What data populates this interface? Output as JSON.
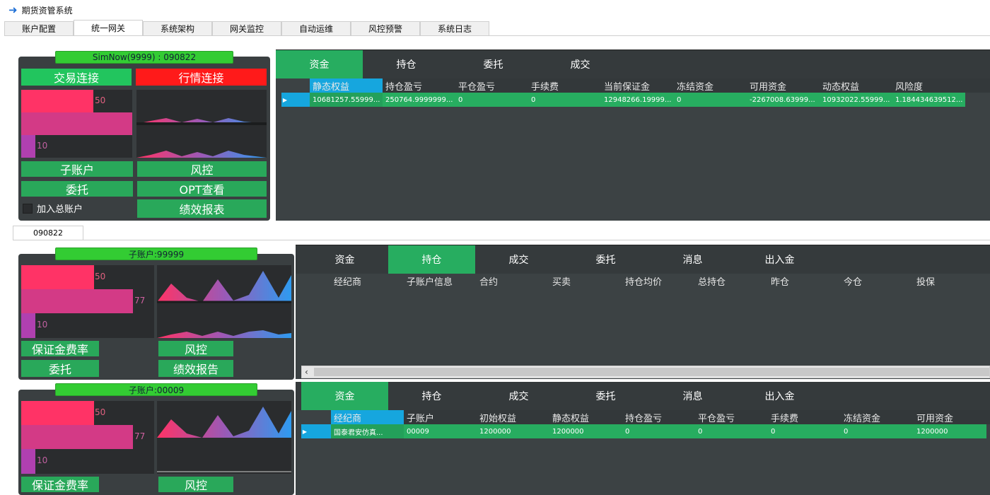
{
  "window": {
    "title": "期货资管系统"
  },
  "main_tabs": [
    {
      "label": "账户配置"
    },
    {
      "label": "统一网关"
    },
    {
      "label": "系统架构"
    },
    {
      "label": "网关监控"
    },
    {
      "label": "自动运维"
    },
    {
      "label": "风控预警"
    },
    {
      "label": "系统日志"
    }
  ],
  "gateway": {
    "label": "SimNow(9999) : 090822",
    "trade_conn": "交易连接",
    "quote_conn": "行情连接",
    "bar_top": "50",
    "bar_bottom": "10",
    "buttons": {
      "sub_account": "子账户",
      "risk": "风控",
      "order": "委托",
      "opt": "OPT查看",
      "report": "绩效报表"
    },
    "checkbox_label": "加入总账户"
  },
  "top_grid": {
    "tabs": [
      "资金",
      "持仓",
      "委托",
      "成交"
    ],
    "headers": [
      "静态权益",
      "持仓盈亏",
      "平仓盈亏",
      "手续费",
      "当前保证金",
      "冻结资金",
      "可用资金",
      "动态权益",
      "风险度"
    ],
    "row": [
      "10681257.55999...",
      "250764.9999999...",
      "0",
      "0",
      "12948266.19999...",
      "0",
      "-2267008.63999...",
      "10932022.55999...",
      "1.184434639512..."
    ]
  },
  "section_tab": "090822",
  "subaccounts": [
    {
      "label": "子账户:99999",
      "bar1": "50",
      "bar2": "77",
      "bar3": "10",
      "btn_margin": "保证金费率",
      "btn_risk": "风控",
      "btn_order": "委托",
      "btn_report": "绩效报告"
    },
    {
      "label": "子账户:00009",
      "bar1": "50",
      "bar2": "77",
      "bar3": "10",
      "btn_margin": "保证金费率",
      "btn_risk": "风控"
    }
  ],
  "mid_grid": {
    "tabs": [
      "资金",
      "持仓",
      "成交",
      "委托",
      "消息",
      "出入金"
    ],
    "headers": [
      "经纪商",
      "子账户信息",
      "合约",
      "买卖",
      "持仓均价",
      "总持仓",
      "昨仓",
      "今仓",
      "投保"
    ]
  },
  "bottom_grid": {
    "tabs": [
      "资金",
      "持仓",
      "成交",
      "委托",
      "消息",
      "出入金"
    ],
    "headers": [
      "经纪商",
      "子账户",
      "初始权益",
      "静态权益",
      "持仓盈亏",
      "平仓盈亏",
      "手续费",
      "冻结资金",
      "可用资金"
    ],
    "row": [
      "国泰君安仿真...",
      "00009",
      "1200000",
      "1200000",
      "0",
      "0",
      "0",
      "0",
      "1200000"
    ]
  },
  "colors": {
    "green": "#27ad60",
    "red": "#ff1a1a",
    "select_blue": "#16a6de",
    "bar_pink": "#ff3366",
    "bar_magenta": "#d33a86"
  }
}
